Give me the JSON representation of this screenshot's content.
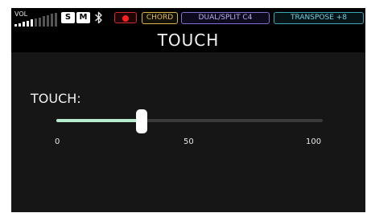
{
  "status_bar": {
    "volume": {
      "label": "VOL",
      "level": 0.45
    },
    "solo_label": "S",
    "mute_label": "M",
    "bluetooth_icon": "bluetooth-icon",
    "record_icon": "record-icon",
    "chord_label": "CHORD",
    "dual_split_label": "DUAL/SPLIT C4",
    "transpose_label": "TRANSPOSE +8"
  },
  "header": {
    "title": "TOUCH"
  },
  "touch_setting": {
    "label": "TOUCH:",
    "value": 32,
    "min": 0,
    "max": 100,
    "ticks": [
      "0",
      "50",
      "100"
    ]
  },
  "colors": {
    "accent_fill": "#b8eccf",
    "chord": "#e0bd57",
    "dual_split": "#b9b0f0",
    "transpose": "#6fd0df",
    "record": "#ff1f1f"
  }
}
